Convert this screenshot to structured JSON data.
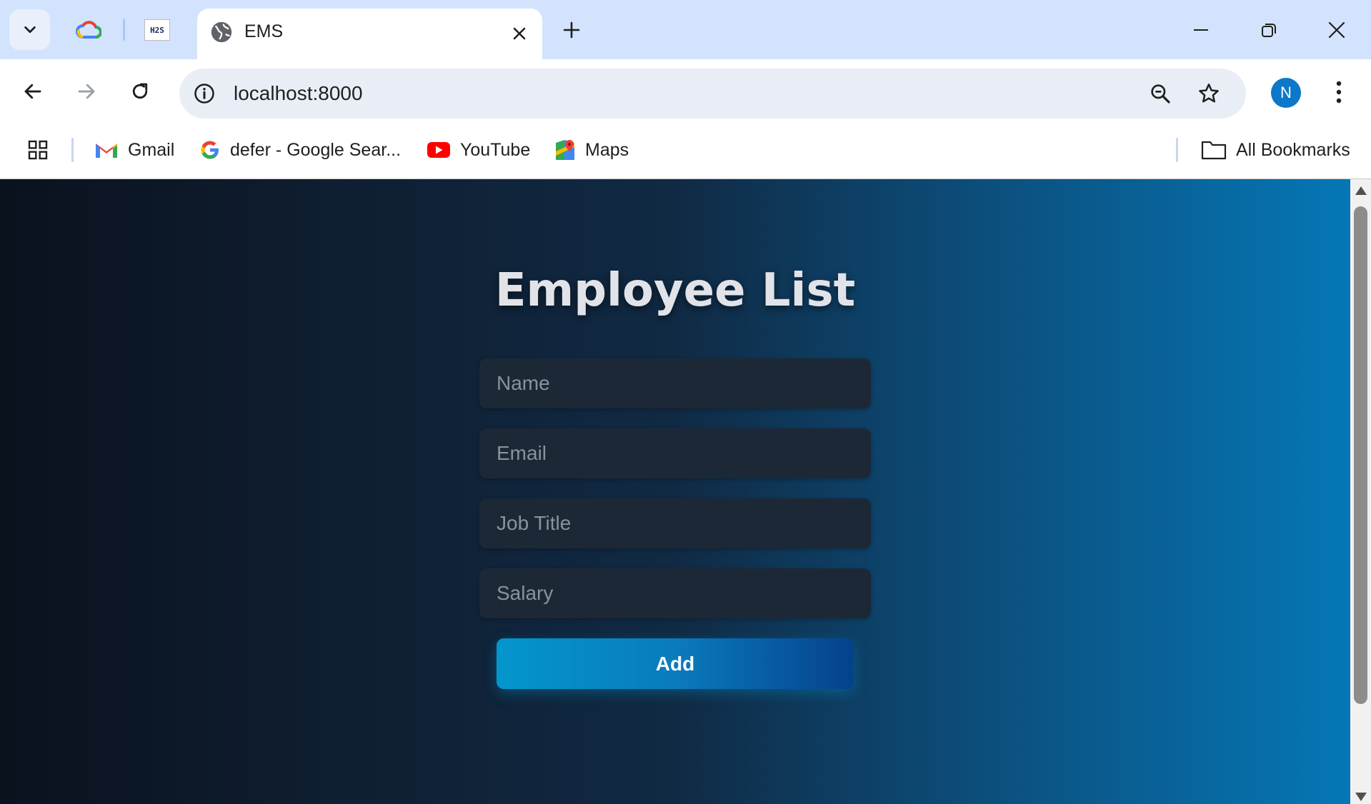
{
  "browser": {
    "active_tab": {
      "title": "EMS"
    },
    "pinned_tabs": [
      {
        "name": "Google Cloud"
      },
      {
        "name": "H2S",
        "label": "H2S"
      }
    ],
    "address_bar": {
      "url": "localhost:8000"
    },
    "profile": {
      "initial": "N"
    },
    "bookmarks": [
      {
        "label": "Gmail",
        "icon": "gmail-icon"
      },
      {
        "label": "defer - Google Sear...",
        "icon": "google-icon"
      },
      {
        "label": "YouTube",
        "icon": "youtube-icon"
      },
      {
        "label": "Maps",
        "icon": "maps-icon"
      }
    ],
    "all_bookmarks_label": "All Bookmarks"
  },
  "page": {
    "title": "Employee List",
    "form": {
      "name_placeholder": "Name",
      "email_placeholder": "Email",
      "job_title_placeholder": "Job Title",
      "salary_placeholder": "Salary",
      "name_value": "",
      "email_value": "",
      "job_title_value": "",
      "salary_value": "",
      "submit_label": "Add"
    }
  },
  "colors": {
    "tabstrip": "#d3e3fd",
    "gradient_start": "#0a121e",
    "gradient_end": "#0577b6",
    "field_background": "#1d2837",
    "button_start": "#0396cc",
    "button_end": "#05418c",
    "avatar": "#0b78c9"
  }
}
